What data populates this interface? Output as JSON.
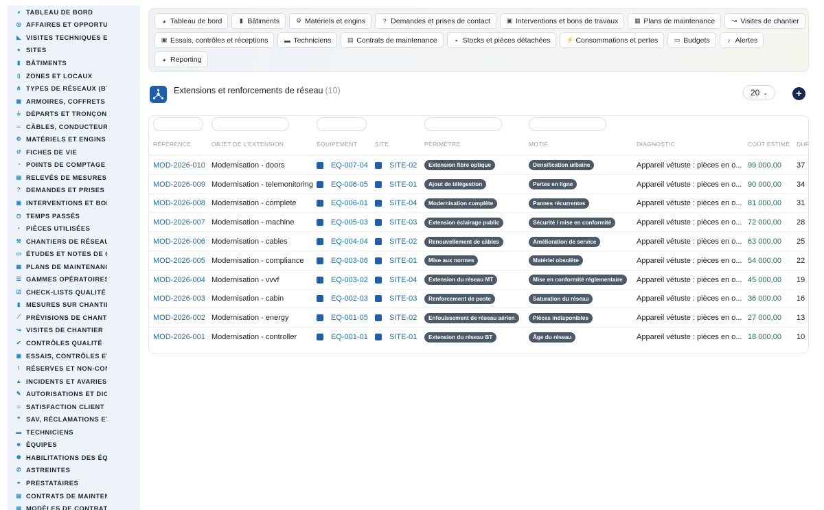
{
  "sidebar": {
    "items": [
      {
        "label": "TABLEAU DE BORD",
        "icon": "dashboard-icon",
        "glyph": "◕"
      },
      {
        "label": "AFFAIRES ET OPPORTUNITÉS",
        "icon": "target-icon",
        "glyph": "◎"
      },
      {
        "label": "VISITES TECHNIQUES ET ÉTUDES",
        "icon": "ruler-icon",
        "glyph": "◣"
      },
      {
        "label": "SITES",
        "icon": "map-marker-icon",
        "glyph": "●"
      },
      {
        "label": "BÂTIMENTS",
        "icon": "building-icon",
        "glyph": "▮"
      },
      {
        "label": "ZONES ET LOCAUX",
        "icon": "door-icon",
        "glyph": "▯"
      },
      {
        "label": "TYPES DE RÉSEAUX (BT / HTA)",
        "icon": "sitemap-icon",
        "glyph": "⋔"
      },
      {
        "label": "ARMOIRES, COFFRETS ET TABLEAUX",
        "icon": "grid-icon",
        "glyph": "▦"
      },
      {
        "label": "DÉPARTS ET TRONÇONS",
        "icon": "plug-icon",
        "glyph": "⏚"
      },
      {
        "label": "CÂBLES, CONDUCTEURS",
        "icon": "lines-icon",
        "glyph": "═"
      },
      {
        "label": "MATÉRIELS ET ENGINS",
        "icon": "cogs-icon",
        "glyph": "⚙"
      },
      {
        "label": "FICHES DE VIE",
        "icon": "history-icon",
        "glyph": "↺"
      },
      {
        "label": "POINTS DE COMPTAGE ET MESURE",
        "icon": "gauge-icon",
        "glyph": "◔"
      },
      {
        "label": "RELEVÉS DE MESURES",
        "icon": "clipboard-icon",
        "glyph": "▤"
      },
      {
        "label": "DEMANDES ET PRISES DE CONTACT",
        "icon": "question-icon",
        "glyph": "?"
      },
      {
        "label": "INTERVENTIONS ET BONS DE TRAVAUX",
        "icon": "clipboard-check-icon",
        "glyph": "▣"
      },
      {
        "label": "TEMPS PASSÉS",
        "icon": "clock-icon",
        "glyph": "◷"
      },
      {
        "label": "PIÈCES UTILISÉES",
        "icon": "box-icon",
        "glyph": "▪"
      },
      {
        "label": "CHANTIERS DE RÉSEAUX",
        "icon": "hammer-icon",
        "glyph": "⚒"
      },
      {
        "label": "ÉTUDES ET NOTES DE CALCUL",
        "icon": "file-icon",
        "glyph": "▭"
      },
      {
        "label": "PLANS DE MAINTENANCE",
        "icon": "calendar-icon",
        "glyph": "▦"
      },
      {
        "label": "GAMMES OPÉRATOIRES",
        "icon": "list-icon",
        "glyph": "☰"
      },
      {
        "label": "CHECK-LISTS QUALITÉ",
        "icon": "checklist-icon",
        "glyph": "☑"
      },
      {
        "label": "MESURES SUR CHANTIER",
        "icon": "thermometer-icon",
        "glyph": "▮"
      },
      {
        "label": "PRÉVISIONS DE CHANTIER",
        "icon": "chart-line-icon",
        "glyph": "⟋"
      },
      {
        "label": "VISITES DE CHANTIER",
        "icon": "route-icon",
        "glyph": "↝"
      },
      {
        "label": "CONTRÔLES QUALITÉ",
        "icon": "check-icon",
        "glyph": "✔"
      },
      {
        "label": "ESSAIS, CONTRÔLES ET RÉCEPTIONS",
        "icon": "clipboard-check-icon",
        "glyph": "▣"
      },
      {
        "label": "RÉSERVES ET NON-CONFORMITÉS",
        "icon": "exclamation-circle-icon",
        "glyph": "!"
      },
      {
        "label": "INCIDENTS ET AVARIES",
        "icon": "warning-icon",
        "glyph": "▲"
      },
      {
        "label": "AUTORISATIONS ET DICT",
        "icon": "file-signature-icon",
        "glyph": "✎"
      },
      {
        "label": "SATISFACTION CLIENT",
        "icon": "smile-icon",
        "glyph": "☺"
      },
      {
        "label": "SAV, RÉCLAMATIONS ET GARANTIES",
        "icon": "comments-icon",
        "glyph": "❞"
      },
      {
        "label": "TECHNICIENS",
        "icon": "hard-hat-icon",
        "glyph": "▬"
      },
      {
        "label": "ÉQUIPES",
        "icon": "users-icon",
        "glyph": "☻"
      },
      {
        "label": "HABILITATIONS DES ÉQUIPES",
        "icon": "certificate-icon",
        "glyph": "✺"
      },
      {
        "label": "ASTREINTES",
        "icon": "phone-icon",
        "glyph": "✆"
      },
      {
        "label": "PRESTATAIRES",
        "icon": "handshake-icon",
        "glyph": "⚭"
      },
      {
        "label": "CONTRATS DE MAINTENANCE",
        "icon": "file-contract-icon",
        "glyph": "▤"
      },
      {
        "label": "MODÈLES DE CONTRATS",
        "icon": "file-alt-icon",
        "glyph": "▤"
      }
    ]
  },
  "topnav": {
    "rows": [
      [
        {
          "label": "Tableau de bord",
          "icon": "dashboard-icon",
          "glyph": "◕"
        },
        {
          "label": "Bâtiments",
          "icon": "building-icon",
          "glyph": "▮"
        },
        {
          "label": "Matériels et engins",
          "icon": "cogs-icon",
          "glyph": "⚙"
        },
        {
          "label": "Demandes et prises de contact",
          "icon": "question-icon",
          "glyph": "?"
        },
        {
          "label": "Interventions et bons de travaux",
          "icon": "clipboard-check-icon",
          "glyph": "▣"
        },
        {
          "label": "Plans de maintenance",
          "icon": "calendar-icon",
          "glyph": "▦"
        },
        {
          "label": "Visites de chantier",
          "icon": "route-icon",
          "glyph": "↝"
        }
      ],
      [
        {
          "label": "Essais, contrôles et réceptions",
          "icon": "clipboard-check-icon",
          "glyph": "▣"
        },
        {
          "label": "Techniciens",
          "icon": "hard-hat-icon",
          "glyph": "▬"
        },
        {
          "label": "Contrats de maintenance",
          "icon": "file-contract-icon",
          "glyph": "▤"
        },
        {
          "label": "Stocks et pièces détachées",
          "icon": "cubes-icon",
          "glyph": "▪"
        },
        {
          "label": "Consommations et pertes",
          "icon": "bolt-icon",
          "glyph": "⚡"
        },
        {
          "label": "Budgets",
          "icon": "money-icon",
          "glyph": "▭"
        },
        {
          "label": "Alertes",
          "icon": "bell-icon",
          "glyph": "♪"
        }
      ],
      [
        {
          "label": "Reporting",
          "icon": "chart-pie-icon",
          "glyph": "◕"
        }
      ]
    ]
  },
  "page": {
    "title": "Extensions et renforcements de réseau",
    "count": "(10)",
    "page_size": "20",
    "add_label": "+",
    "title_icon": "network-icon"
  },
  "table": {
    "headers": {
      "reference": "RÉFÉRENCE",
      "objet": "OBJET DE L'EXTENSION",
      "equipement": "ÉQUIPEMENT",
      "site": "SITE",
      "perimetre": "PÉRIMÈTRE",
      "motif": "MOTIF",
      "diagnostic": "DIAGNOSTIC",
      "cout": "COÛT ESTIMÉ",
      "duree": "DURÉE"
    },
    "rows": [
      {
        "reference": "MOD-2026-010",
        "objet": "Modernisation - doors",
        "equipement": "EQ-007-04",
        "site": "SITE-02",
        "perimetre": "Extension fibre optique",
        "motif": "Densification urbaine",
        "diagnostic": "Appareil vétuste : pièces en o...",
        "cout": "99 000,00",
        "duree": "37"
      },
      {
        "reference": "MOD-2026-009",
        "objet": "Modernisation - telemonitoring",
        "equipement": "EQ-006-05",
        "site": "SITE-01",
        "perimetre": "Ajout de télégestion",
        "motif": "Pertes en ligne",
        "diagnostic": "Appareil vétuste : pièces en o...",
        "cout": "90 000,00",
        "duree": "34"
      },
      {
        "reference": "MOD-2026-008",
        "objet": "Modernisation - complete",
        "equipement": "EQ-006-01",
        "site": "SITE-04",
        "perimetre": "Modernisation complète",
        "motif": "Pannes récurrentes",
        "diagnostic": "Appareil vétuste : pièces en o...",
        "cout": "81 000,00",
        "duree": "31"
      },
      {
        "reference": "MOD-2026-007",
        "objet": "Modernisation - machine",
        "equipement": "EQ-005-03",
        "site": "SITE-03",
        "perimetre": "Extension éclairage public",
        "motif": "Sécurité / mise en conformité",
        "diagnostic": "Appareil vétuste : pièces en o...",
        "cout": "72 000,00",
        "duree": "28"
      },
      {
        "reference": "MOD-2026-006",
        "objet": "Modernisation - cables",
        "equipement": "EQ-004-04",
        "site": "SITE-02",
        "perimetre": "Renouvellement de câbles",
        "motif": "Amélioration de service",
        "diagnostic": "Appareil vétuste : pièces en o...",
        "cout": "63 000,00",
        "duree": "25"
      },
      {
        "reference": "MOD-2026-005",
        "objet": "Modernisation - compliance",
        "equipement": "EQ-003-06",
        "site": "SITE-01",
        "perimetre": "Mise aux normes",
        "motif": "Matériel obsolète",
        "diagnostic": "Appareil vétuste : pièces en o...",
        "cout": "54 000,00",
        "duree": "22"
      },
      {
        "reference": "MOD-2026-004",
        "objet": "Modernisation - vvvf",
        "equipement": "EQ-003-02",
        "site": "SITE-04",
        "perimetre": "Extension du réseau MT",
        "motif": "Mise en conformité réglementaire",
        "diagnostic": "Appareil vétuste : pièces en o...",
        "cout": "45 000,00",
        "duree": "19"
      },
      {
        "reference": "MOD-2026-003",
        "objet": "Modernisation - cabin",
        "equipement": "EQ-002-03",
        "site": "SITE-03",
        "perimetre": "Renforcement de poste",
        "motif": "Saturation du réseau",
        "diagnostic": "Appareil vétuste : pièces en o...",
        "cout": "36 000,00",
        "duree": "16"
      },
      {
        "reference": "MOD-2026-002",
        "objet": "Modernisation - energy",
        "equipement": "EQ-001-05",
        "site": "SITE-02",
        "perimetre": "Enfouissement de réseau aérien",
        "motif": "Pièces indisponibles",
        "diagnostic": "Appareil vétuste : pièces en o...",
        "cout": "27 000,00",
        "duree": "13"
      },
      {
        "reference": "MOD-2026-001",
        "objet": "Modernisation - controller",
        "equipement": "EQ-001-01",
        "site": "SITE-01",
        "perimetre": "Extension du réseau BT",
        "motif": "Âge du réseau",
        "diagnostic": "Appareil vétuste : pièces en o...",
        "cout": "18 000,00",
        "duree": "10"
      }
    ]
  }
}
